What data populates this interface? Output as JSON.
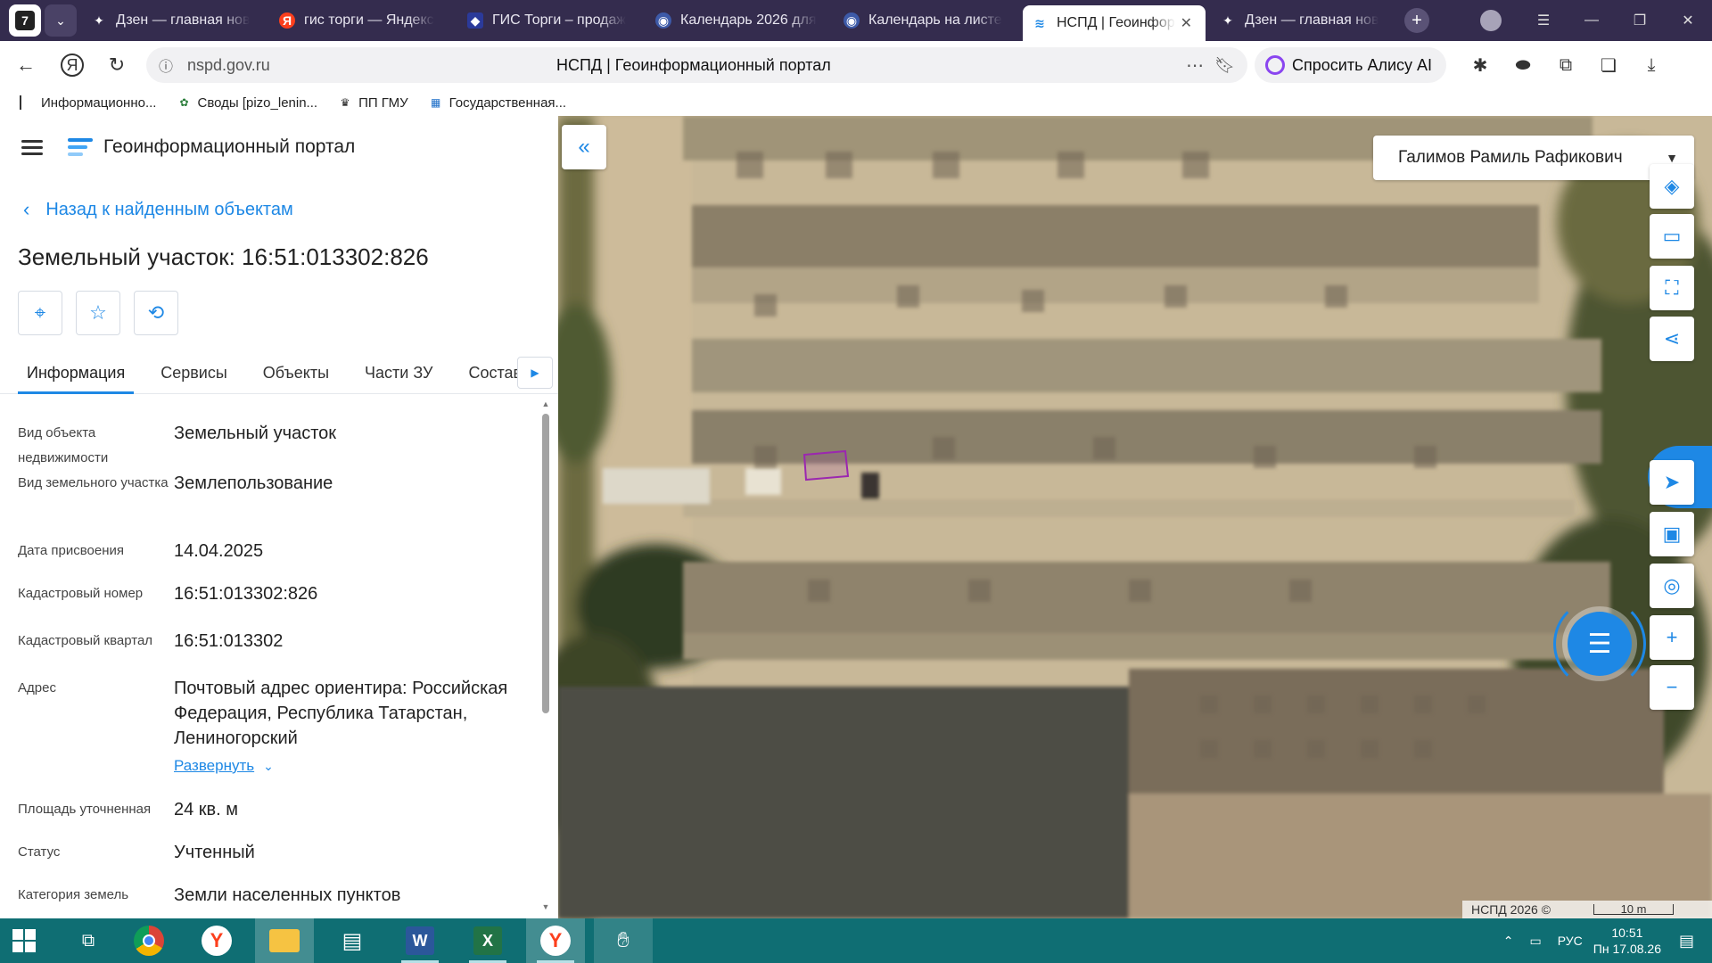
{
  "browser": {
    "tab_count": "7",
    "tabs": [
      {
        "title": "Дзен — главная нов",
        "icon": "dzen-icon"
      },
      {
        "title": "гис торги — Яндекс",
        "icon": "yandex-icon"
      },
      {
        "title": "ГИС Торги – продаж",
        "icon": "gis-icon"
      },
      {
        "title": "Календарь 2026 для",
        "icon": "calendar-icon"
      },
      {
        "title": "Календарь на листе",
        "icon": "calendar-icon"
      },
      {
        "title": "НСПД | Геоинфор",
        "icon": "nspd-icon",
        "active": true
      },
      {
        "title": "Дзен — главная нов",
        "icon": "dzen-icon"
      }
    ],
    "url": "nspd.gov.ru",
    "page_title": "НСПД | Геоинформационный портал",
    "alice_label": "Спросить Алису AI",
    "bookmarks": [
      "Информационно...",
      "Своды [pizo_lenin...",
      "ПП ГМУ",
      "Государственная..."
    ]
  },
  "panel": {
    "portal_title": "Геоинформационный портал",
    "back_label": "Назад к найденным объектам",
    "object_title": "Земельный участок: 16:51:013302:826",
    "tabs": [
      "Информация",
      "Сервисы",
      "Объекты",
      "Части ЗУ",
      "Состав"
    ],
    "properties": [
      {
        "label": "Вид объекта недвижимости",
        "value": "Земельный участок"
      },
      {
        "label": "Вид земельного участка",
        "value": "Землепользование"
      },
      {
        "label": "Дата присвоения",
        "value": "14.04.2025"
      },
      {
        "label": "Кадастровый номер",
        "value": "16:51:013302:826"
      },
      {
        "label": "Кадастровый квартал",
        "value": "16:51:013302"
      },
      {
        "label": "Адрес",
        "value": "Почтовый адрес ориентира: Российская Федерация, Республика Татарстан, Лениногорский"
      },
      {
        "label": "Площадь уточненная",
        "value": "24 кв. м"
      },
      {
        "label": "Статус",
        "value": "Учтенный"
      },
      {
        "label": "Категория земель",
        "value": "Земли населенных пунктов"
      }
    ],
    "expand_label": "Развернуть"
  },
  "map": {
    "user_name": "Галимов Рамиль Рафикович",
    "attribution": "НСПД 2026 ©",
    "scale_label": "10 m",
    "parcel_color": "#9b27b0",
    "accent": "#1e88e5"
  },
  "taskbar": {
    "language": "РУС",
    "time": "10:51",
    "date": "Пн 17.08.26"
  }
}
